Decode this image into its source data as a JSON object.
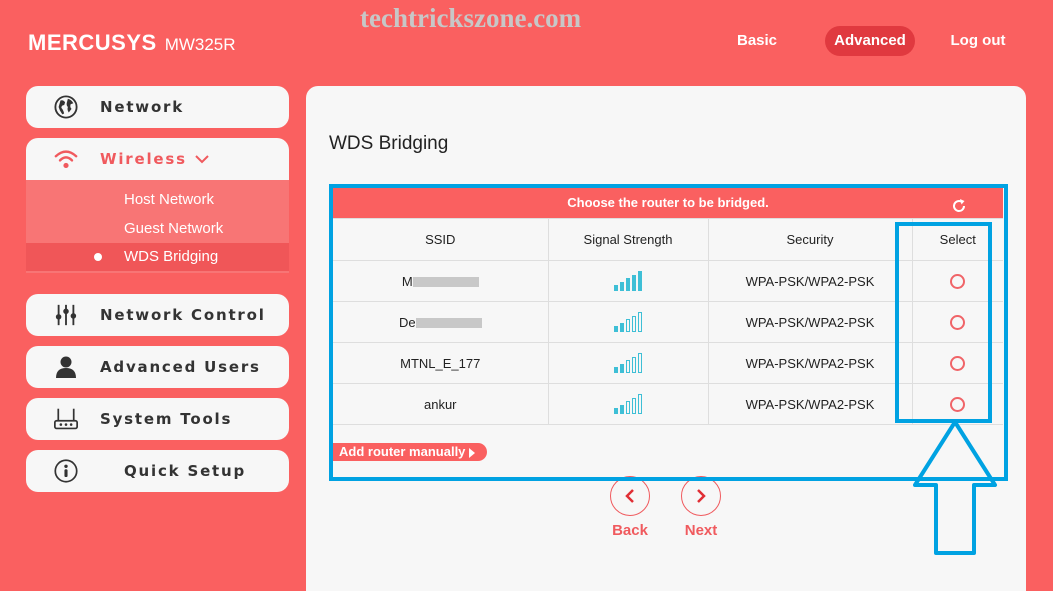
{
  "header": {
    "brand": "MERCUSYS",
    "model": "MW325R",
    "watermark": "techtrickszone.com",
    "nav": {
      "basic": "Basic",
      "advanced": "Advanced",
      "logout": "Log out"
    },
    "active_nav": "Advanced"
  },
  "sidebar": {
    "items": [
      {
        "label": "Network",
        "icon": "globe-icon"
      },
      {
        "label": "Wireless",
        "icon": "wifi-icon",
        "expanded": true
      },
      {
        "label": "Network Control",
        "icon": "sliders-icon"
      },
      {
        "label": "Advanced Users",
        "icon": "user-icon"
      },
      {
        "label": "System Tools",
        "icon": "router-icon"
      },
      {
        "label": "Quick Setup",
        "icon": "info-icon"
      }
    ],
    "wireless_sub": [
      {
        "label": "Host Network"
      },
      {
        "label": "Guest Network"
      },
      {
        "label": "WDS Bridging",
        "selected": true
      }
    ]
  },
  "main": {
    "title": "WDS Bridging",
    "table_banner": "Choose the router to be bridged.",
    "columns": [
      "SSID",
      "Signal Strength",
      "Security",
      "Select"
    ],
    "rows": [
      {
        "ssid": "M",
        "ssid_masked": true,
        "signal_bars": 5,
        "security": "WPA-PSK/WPA2-PSK",
        "selected": false
      },
      {
        "ssid": "De",
        "ssid_masked": true,
        "signal_bars": 2,
        "security": "WPA-PSK/WPA2-PSK",
        "selected": false
      },
      {
        "ssid": "MTNL_E_177",
        "ssid_masked": false,
        "signal_bars": 2,
        "security": "WPA-PSK/WPA2-PSK",
        "selected": false
      },
      {
        "ssid": "ankur",
        "ssid_masked": false,
        "signal_bars": 2,
        "security": "WPA-PSK/WPA2-PSK",
        "selected": false
      }
    ],
    "signal_max_bars": 5,
    "add_router": "Add router manually",
    "back": "Back",
    "next": "Next"
  },
  "colors": {
    "brand_red": "#fa6060",
    "active_red": "#e0393f",
    "signal_blue": "#3ebfd6",
    "annotation_blue": "#00a2e2"
  }
}
